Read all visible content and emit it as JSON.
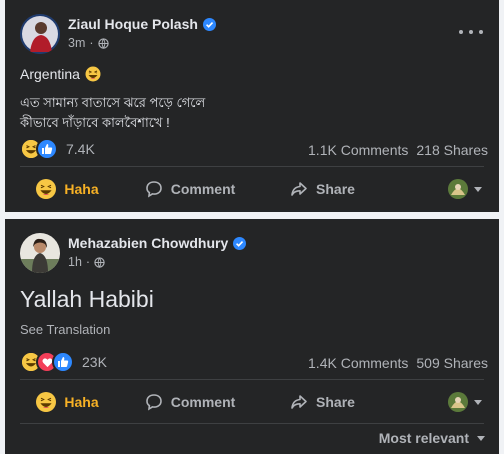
{
  "colors": {
    "accent": "#2d88ff",
    "haha": "#f7b125",
    "love": "#f33e58",
    "card": "#242526",
    "muted": "#b0b3b8"
  },
  "icons": [
    "verified-badge-icon",
    "globe-icon",
    "more-options-icon",
    "haha-emoji-icon",
    "like-icon",
    "love-icon",
    "comment-icon",
    "share-icon",
    "chevron-down-icon"
  ],
  "posts": [
    {
      "author": "Ziaul Hoque Polash",
      "time": "3m",
      "dot": "·",
      "text_title": "Argentina",
      "text_line1": "এত সামান্য বাতাসে ঝরে পড়ে গেলে",
      "text_line2": "কীভাবে দাঁড়াবে কালবৈশাখে !",
      "reaction_count": "7.4K",
      "comments": "1.1K Comments",
      "shares": "218 Shares",
      "actions": {
        "react": "Haha",
        "comment": "Comment",
        "share": "Share"
      }
    },
    {
      "author": "Mehazabien Chowdhury",
      "time": "1h",
      "dot": "·",
      "text_title": "Yallah Habibi",
      "see_translation": "See Translation",
      "reaction_count": "23K",
      "comments": "1.4K Comments",
      "shares": "509 Shares",
      "actions": {
        "react": "Haha",
        "comment": "Comment",
        "share": "Share"
      }
    }
  ],
  "sort_label": "Most relevant"
}
